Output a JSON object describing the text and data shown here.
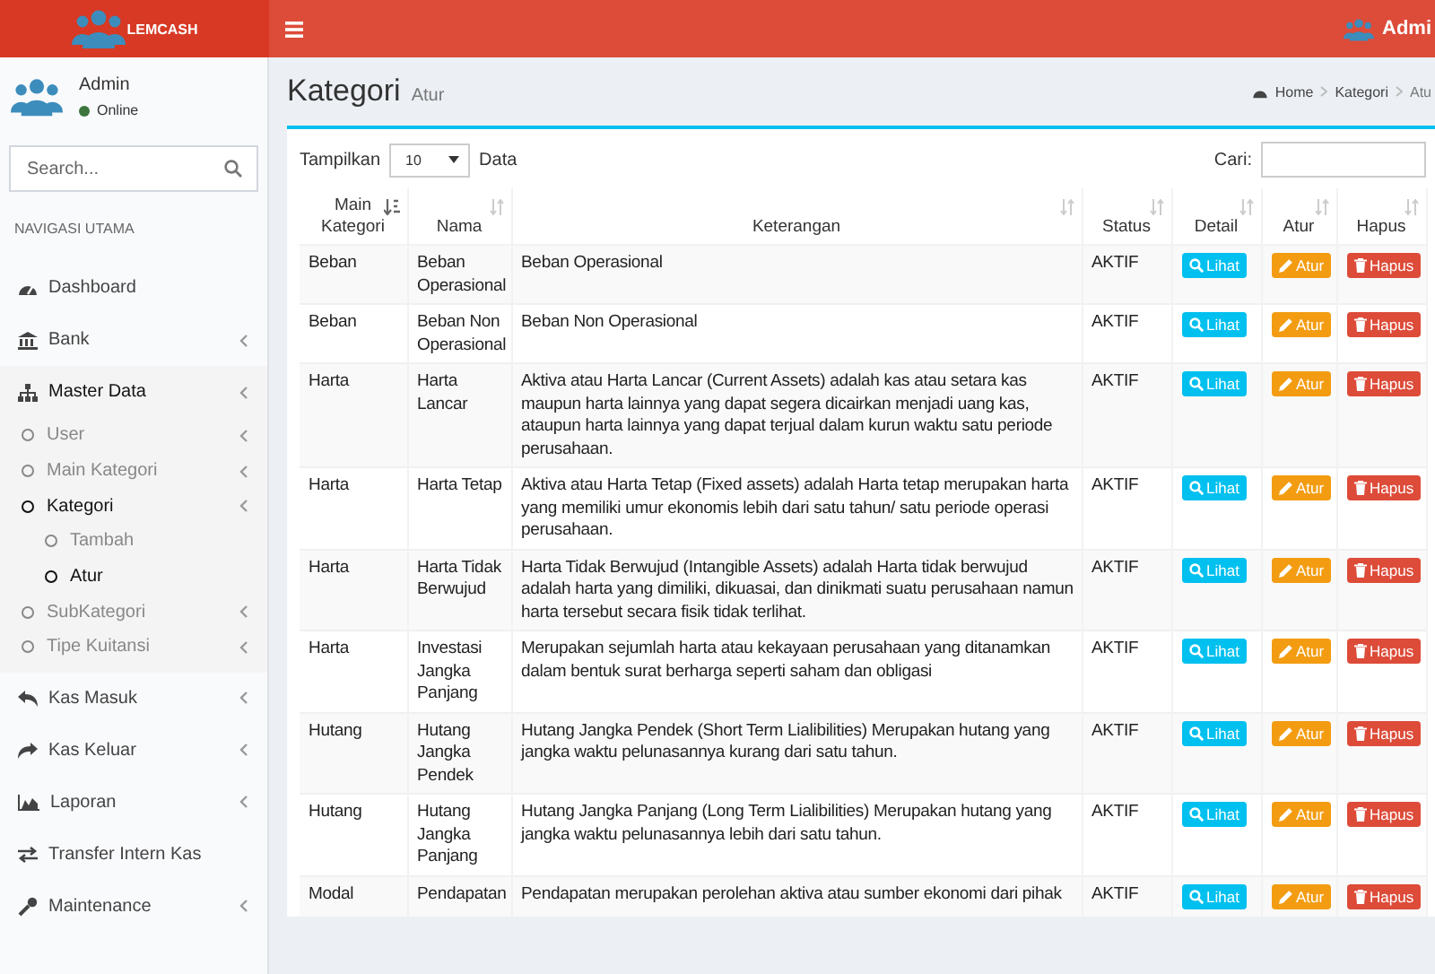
{
  "header": {
    "logo_text": "LEMCASH",
    "user_name": "Admi"
  },
  "user_panel": {
    "name": "Admin",
    "status": "Online",
    "online": true
  },
  "search": {
    "placeholder": "Search..."
  },
  "nav_header": "NAVIGASI UTAMA",
  "sidebar": {
    "items": [
      {
        "label": "Dashboard",
        "expandable": false,
        "selected": false
      },
      {
        "label": "Bank",
        "expandable": true,
        "expanded": false,
        "selected": false
      },
      {
        "label": "Master Data",
        "expandable": true,
        "expanded": true,
        "selected": true,
        "children": [
          {
            "label": "User",
            "expandable": true,
            "expanded": false,
            "selected": false
          },
          {
            "label": "Main Kategori",
            "expandable": true,
            "expanded": false,
            "selected": false
          },
          {
            "label": "Kategori",
            "expandable": true,
            "expanded": true,
            "selected": true,
            "children": [
              {
                "label": "Tambah",
                "selected": false
              },
              {
                "label": "Atur",
                "selected": true
              }
            ]
          },
          {
            "label": "SubKategori",
            "expandable": true,
            "expanded": false,
            "selected": false
          },
          {
            "label": "Tipe Kuitansi",
            "expandable": true,
            "expanded": false,
            "selected": false
          }
        ]
      },
      {
        "label": "Kas Masuk",
        "expandable": true,
        "expanded": false,
        "selected": false
      },
      {
        "label": "Kas Keluar",
        "expandable": true,
        "expanded": false,
        "selected": false
      },
      {
        "label": "Laporan",
        "expandable": true,
        "expanded": false,
        "selected": false
      },
      {
        "label": "Transfer Intern Kas",
        "expandable": false,
        "selected": false
      },
      {
        "label": "Maintenance",
        "expandable": true,
        "expanded": false,
        "selected": false
      }
    ]
  },
  "page": {
    "title": "Kategori",
    "subtitle": "Atur"
  },
  "breadcrumb": [
    "Home",
    "Kategori",
    "Atu"
  ],
  "table_controls": {
    "show_label": "Tampilkan",
    "page_size": "10",
    "show_suffix": "Data",
    "search_label": "Cari:"
  },
  "table": {
    "columns": [
      {
        "label": "Main Kategori",
        "sorted": true
      },
      {
        "label": "Nama",
        "sorted": false
      },
      {
        "label": "Keterangan",
        "sorted": false
      },
      {
        "label": "Status",
        "sorted": false
      },
      {
        "label": "Detail",
        "sorted": false
      },
      {
        "label": "Atur",
        "sorted": false
      },
      {
        "label": "Hapus",
        "sorted": false
      }
    ],
    "rows": [
      {
        "main_kategori": "Beban",
        "nama": "Beban Operasional",
        "keterangan": "Beban Operasional",
        "status": "AKTIF",
        "detail": "Lihat",
        "atur": "Atur",
        "hapus": "Hapus"
      },
      {
        "main_kategori": "Beban",
        "nama": "Beban Non Operasional",
        "keterangan": "Beban Non Operasional",
        "status": "AKTIF",
        "detail": "Lihat",
        "atur": "Atur",
        "hapus": "Hapus"
      },
      {
        "main_kategori": "Harta",
        "nama": "Harta Lancar",
        "keterangan": "Aktiva atau Harta Lancar (Current Assets) adalah kas atau setara kas maupun harta lainnya yang dapat segera dicairkan menjadi uang kas, ataupun harta lainnya yang dapat terjual dalam kurun waktu satu periode perusahaan.",
        "status": "AKTIF",
        "detail": "Lihat",
        "atur": "Atur",
        "hapus": "Hapus"
      },
      {
        "main_kategori": "Harta",
        "nama": "Harta Tetap",
        "keterangan": "Aktiva atau Harta Tetap (Fixed assets) adalah Harta tetap merupakan harta yang memiliki umur ekonomis lebih dari satu tahun/ satu periode operasi perusahaan.",
        "status": "AKTIF",
        "detail": "Lihat",
        "atur": "Atur",
        "hapus": "Hapus"
      },
      {
        "main_kategori": "Harta",
        "nama": "Harta Tidak Berwujud",
        "keterangan": "Harta Tidak Berwujud (Intangible Assets) adalah Harta tidak berwujud adalah harta yang dimiliki, dikuasai, dan dinikmati suatu perusahaan namun harta tersebut secara fisik tidak terlihat.",
        "status": "AKTIF",
        "detail": "Lihat",
        "atur": "Atur",
        "hapus": "Hapus"
      },
      {
        "main_kategori": "Harta",
        "nama": "Investasi Jangka Panjang",
        "keterangan": "Merupakan sejumlah harta atau kekayaan perusahaan yang ditanamkan dalam bentuk surat berharga seperti saham dan obligasi",
        "status": "AKTIF",
        "detail": "Lihat",
        "atur": "Atur",
        "hapus": "Hapus"
      },
      {
        "main_kategori": "Hutang",
        "nama": "Hutang Jangka Pendek",
        "keterangan": "Hutang Jangka Pendek (Short Term Lialibilities) Merupakan hutang yang jangka waktu pelunasannya kurang dari satu tahun.",
        "status": "AKTIF",
        "detail": "Lihat",
        "atur": "Atur",
        "hapus": "Hapus"
      },
      {
        "main_kategori": "Hutang",
        "nama": "Hutang Jangka Panjang",
        "keterangan": "Hutang Jangka Panjang (Long Term Lialibilities) Merupakan hutang yang jangka waktu pelunasannya lebih dari satu tahun.",
        "status": "AKTIF",
        "detail": "Lihat",
        "atur": "Atur",
        "hapus": "Hapus"
      },
      {
        "main_kategori": "Modal",
        "nama": "Pendapatan",
        "keterangan": "Pendapatan merupakan perolehan aktiva atau sumber ekonomi dari pihak",
        "status": "AKTIF",
        "detail": "Lihat",
        "atur": "Atur",
        "hapus": "Hapus"
      }
    ]
  }
}
